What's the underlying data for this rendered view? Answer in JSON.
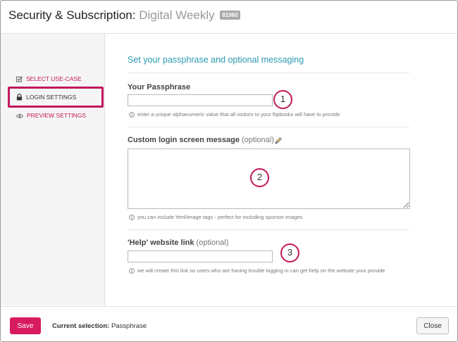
{
  "header": {
    "title_main": "Security & Subscription:",
    "title_sub": "Digital Weekly",
    "badge": "81060"
  },
  "sidebar": {
    "items": [
      {
        "label": "SELECT USE-CASE",
        "icon": "checkbox-icon"
      },
      {
        "label": "LOGIN SETTINGS",
        "icon": "lock-icon"
      },
      {
        "label": "PREVIEW SETTINGS",
        "icon": "eye-icon"
      }
    ]
  },
  "main": {
    "section_title": "Set your passphrase and optional messaging",
    "passphrase": {
      "label": "Your Passphrase",
      "value": "",
      "hint": "enter a unique alphanumeric value that all visitors to your flipbooks will have to provide"
    },
    "login_message": {
      "label": "Custom login screen message",
      "optional": "(optional)",
      "value": "",
      "hint": "you can include html/image tags - perfect for including sponsor images"
    },
    "help_link": {
      "label": "'Help' website link",
      "optional": "(optional)",
      "value": "",
      "hint": "we will create this link so users who are having trouble logging in can get help on the website your provide"
    },
    "annotations": [
      "1",
      "2",
      "3"
    ]
  },
  "footer": {
    "save_label": "Save",
    "current_label": "Current selection:",
    "current_value": "Passphrase",
    "close_label": "Close"
  },
  "colors": {
    "accent": "#c2185b",
    "save_button": "#d81b60",
    "section_title": "#2a9ab0"
  }
}
